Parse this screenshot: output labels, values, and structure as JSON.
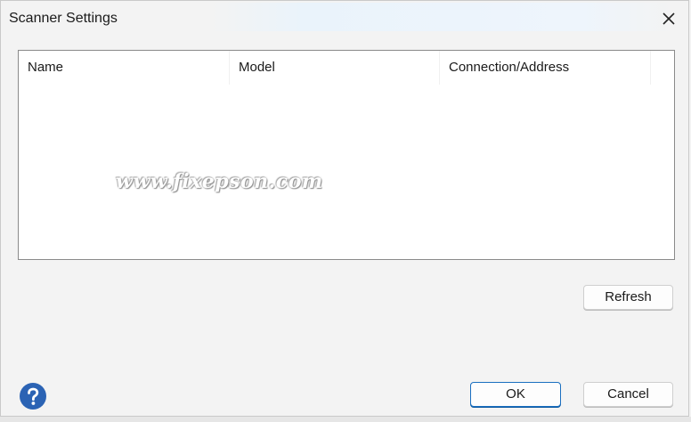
{
  "window": {
    "title": "Scanner Settings"
  },
  "icons": {
    "close": "close-icon",
    "help": "help-icon"
  },
  "list": {
    "columns": [
      "Name",
      "Model",
      "Connection/Address",
      ""
    ],
    "rows": []
  },
  "watermark": "www.fixepson.com",
  "buttons": {
    "refresh": "Refresh",
    "ok": "OK",
    "cancel": "Cancel"
  },
  "colors": {
    "accent": "#1a6fc0",
    "help_icon": "#2b63b4"
  }
}
